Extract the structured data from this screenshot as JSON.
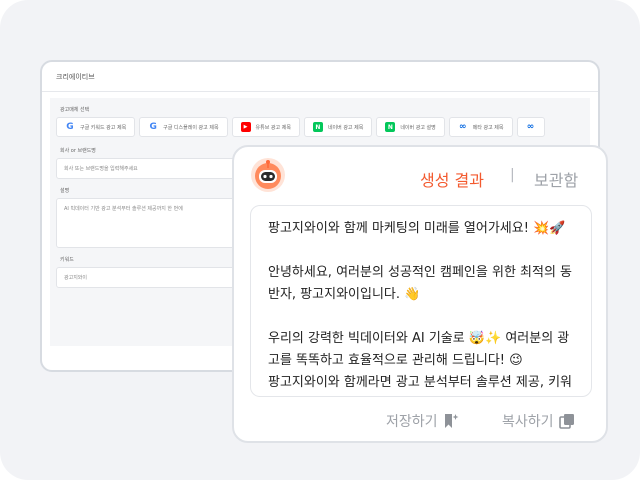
{
  "background_window": {
    "title": "크리에이티브",
    "platform_label": "광고매체 선택",
    "platforms": [
      {
        "label": "구글 키워드 광고 제목",
        "icon": "google-icon"
      },
      {
        "label": "구글 디스플레이 광고 제목",
        "icon": "google-icon"
      },
      {
        "label": "유튜브 광고 제목",
        "icon": "youtube-icon"
      },
      {
        "label": "네이버 광고 제목",
        "icon": "naver-icon"
      },
      {
        "label": "네이버 광고 설명",
        "icon": "naver-icon"
      },
      {
        "label": "메타 광고 제목",
        "icon": "meta-icon"
      },
      {
        "label": "",
        "icon": "meta-icon"
      }
    ],
    "brand_label": "회사 or 브랜드명",
    "brand_placeholder": "회사 또는 브랜드명을 입력해주세요",
    "desc_label": "설명",
    "desc_value": "AI 빅데이터 기반 광고 분석부터 솔루션 제공까지 한 번에",
    "keyword_label": "키워드",
    "keyword_value": "광고지와이"
  },
  "card": {
    "tabs": {
      "result": "생성 결과",
      "separator": "|",
      "archive": "보관함"
    },
    "content": {
      "p1": "팡고지와이와 함께 마케팅의 미래를 열어가세요! 💥🚀",
      "p2": "안녕하세요, 여러분의 성공적인 캠페인을 위한 최적의 동반자, 팡고지와이입니다. 👋",
      "p3": "우리의 강력한 빅데이터와 AI 기술로 🤯✨ 여러분의 광고를 똑똑하고 효율적으로 관리해 드립니다! 😉",
      "p4": "팡고지와이와 함께라면 광고 분석부터 솔루션 제공, 키워"
    },
    "actions": {
      "save": "저장하기",
      "copy": "복사하기"
    }
  },
  "colors": {
    "accent": "#f35a2f",
    "muted": "#9ea2a8"
  }
}
